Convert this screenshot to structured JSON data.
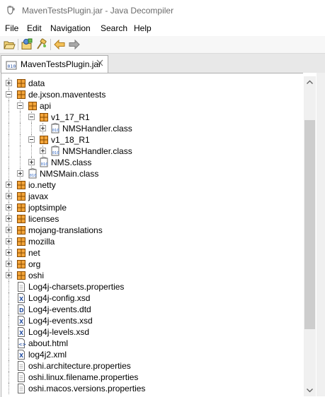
{
  "window": {
    "title": "MavenTestsPlugin.jar - Java Decompiler"
  },
  "menu": [
    "File",
    "Edit",
    "Navigation",
    "Search",
    "Help"
  ],
  "toolbar": {
    "buttons": [
      "open-file-icon",
      "open-type-icon",
      "open-type-hierarchy-icon",
      "back-icon",
      "forward-icon"
    ]
  },
  "tab": {
    "label": "MavenTestsPlugin.jar"
  },
  "tree": [
    {
      "label": "data",
      "depth": 0,
      "type": "package",
      "expander": "plus"
    },
    {
      "label": "de.jxson.maventests",
      "depth": 0,
      "type": "package",
      "expander": "minus"
    },
    {
      "label": "api",
      "depth": 1,
      "type": "package",
      "expander": "minus"
    },
    {
      "label": "v1_17_R1",
      "depth": 2,
      "type": "package",
      "expander": "minus"
    },
    {
      "label": "NMSHandler.class",
      "depth": 3,
      "type": "class",
      "expander": "plus"
    },
    {
      "label": "v1_18_R1",
      "depth": 2,
      "type": "package",
      "expander": "minus"
    },
    {
      "label": "NMSHandler.class",
      "depth": 3,
      "type": "class",
      "expander": "plus"
    },
    {
      "label": "NMS.class",
      "depth": 2,
      "type": "class",
      "expander": "plus"
    },
    {
      "label": "NMSMain.class",
      "depth": 1,
      "type": "class",
      "expander": "plus"
    },
    {
      "label": "io.netty",
      "depth": 0,
      "type": "package",
      "expander": "plus"
    },
    {
      "label": "javax",
      "depth": 0,
      "type": "package",
      "expander": "plus"
    },
    {
      "label": "joptsimple",
      "depth": 0,
      "type": "package",
      "expander": "plus"
    },
    {
      "label": "licenses",
      "depth": 0,
      "type": "package",
      "expander": "plus"
    },
    {
      "label": "mojang-translations",
      "depth": 0,
      "type": "package",
      "expander": "plus"
    },
    {
      "label": "mozilla",
      "depth": 0,
      "type": "package",
      "expander": "plus"
    },
    {
      "label": "net",
      "depth": 0,
      "type": "package",
      "expander": "plus"
    },
    {
      "label": "org",
      "depth": 0,
      "type": "package",
      "expander": "plus"
    },
    {
      "label": "oshi",
      "depth": 0,
      "type": "package",
      "expander": "plus"
    },
    {
      "label": "Log4j-charsets.properties",
      "depth": 0,
      "type": "file",
      "expander": "none"
    },
    {
      "label": "Log4j-config.xsd",
      "depth": 0,
      "type": "xml",
      "expander": "none"
    },
    {
      "label": "Log4j-events.dtd",
      "depth": 0,
      "type": "dtd",
      "expander": "none"
    },
    {
      "label": "Log4j-events.xsd",
      "depth": 0,
      "type": "xml",
      "expander": "none"
    },
    {
      "label": "Log4j-levels.xsd",
      "depth": 0,
      "type": "xml",
      "expander": "none"
    },
    {
      "label": "about.html",
      "depth": 0,
      "type": "html",
      "expander": "none"
    },
    {
      "label": "log4j2.xml",
      "depth": 0,
      "type": "xml",
      "expander": "none"
    },
    {
      "label": "oshi.architecture.properties",
      "depth": 0,
      "type": "file",
      "expander": "none"
    },
    {
      "label": "oshi.linux.filename.properties",
      "depth": 0,
      "type": "file",
      "expander": "none"
    },
    {
      "label": "oshi.macos.versions.properties",
      "depth": 0,
      "type": "file",
      "expander": "none"
    }
  ],
  "colors": {
    "package_fill": "#f3a53a",
    "package_stroke": "#8a4b00",
    "class_fill": "#3a6ec8",
    "xml_mark": "#2b55a6",
    "back_arrow": "#e8a33a",
    "forward_arrow": "#9a9a9a"
  }
}
